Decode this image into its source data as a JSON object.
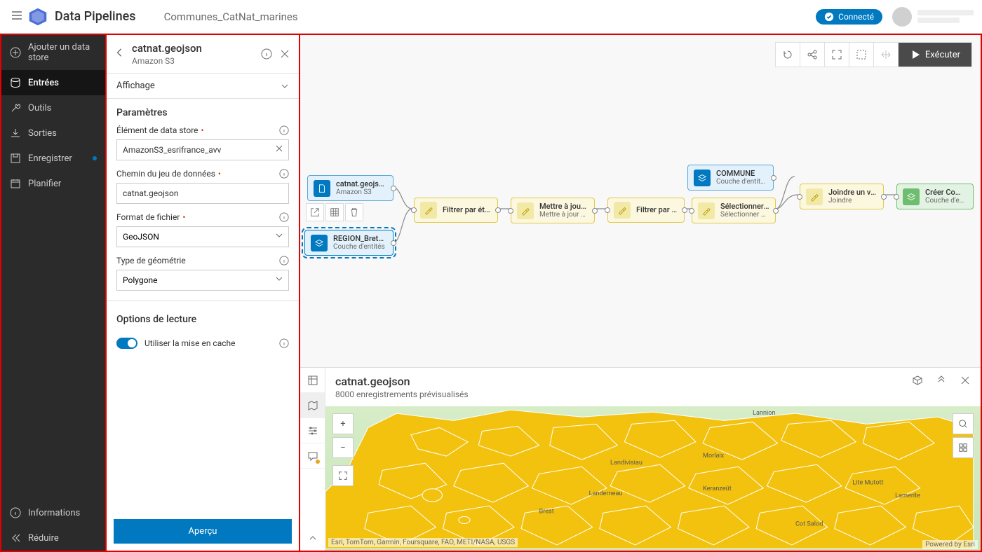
{
  "app_title": "Data Pipelines",
  "breadcrumb": "Communes_CatNat_marines",
  "connected_label": "Connecté",
  "nav": {
    "add_store": "Ajouter un data store",
    "inputs": "Entrées",
    "tools": "Outils",
    "outputs": "Sorties",
    "save": "Enregistrer",
    "schedule": "Planifier",
    "info": "Informations",
    "reduce": "Réduire"
  },
  "panel": {
    "title": "catnat.geojson",
    "subtitle": "Amazon S3",
    "display": "Affichage",
    "params": "Paramètres",
    "el_label": "Élément de data store",
    "el_value": "AmazonS3_esrifrance_avv",
    "path_label": "Chemin du jeu de données",
    "path_value": "catnat.geojson",
    "fmt_label": "Format de fichier",
    "fmt_value": "GeoJSON",
    "geom_label": "Type de géométrie",
    "geom_value": "Polygone",
    "read_opts": "Options de lecture",
    "cache_label": "Utiliser la mise en cache",
    "preview_btn": "Aperçu"
  },
  "toolbar": {
    "run": "Exécuter"
  },
  "nodes": {
    "catnat": {
      "title": "catnat.geojson",
      "sub": "Amazon S3"
    },
    "region": {
      "title": "REGION_Bretagne",
      "sub": "Couche d'entités"
    },
    "commune": {
      "title": "COMMUNE",
      "sub": "Couche d'entités"
    },
    "filter_extent": {
      "title": "Filtrer par étendue",
      "sub": ""
    },
    "update_fields": {
      "title": "Mettre à jour des champs",
      "sub": "Mettre à jour des champs"
    },
    "filter_attr": {
      "title": "Filtrer par attribut",
      "sub": ""
    },
    "select_fields": {
      "title": "Sélectionner des champs",
      "sub": "Sélectionner des champs"
    },
    "join": {
      "title": "Joindre un vers un",
      "sub": "Joindre"
    },
    "create": {
      "title": "Créer Communes_Cat",
      "sub": "Couche d'entités"
    }
  },
  "preview": {
    "title": "catnat.geojson",
    "subtitle": "8000 enregistrements prévisualisés",
    "attr_top": "Esri, TomTom, Garmin, Foursquare, FAO, METI/NASA, USGS",
    "attr_bot": "Powered by Esri",
    "cities": [
      "Lannion",
      "Morlaix",
      "Landivisiau",
      "Brest",
      "Landerneau",
      "Keranzeüt",
      "Lite Mutott",
      "Lamerite",
      "Cot Salod"
    ]
  }
}
